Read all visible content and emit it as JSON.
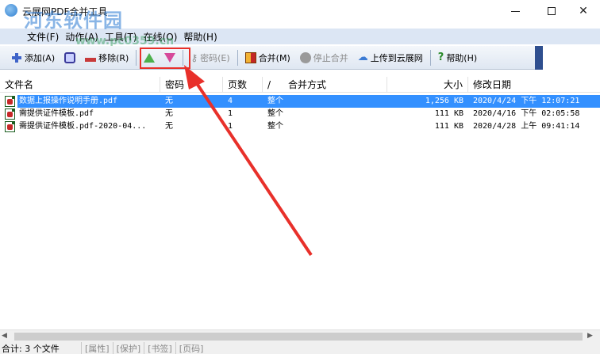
{
  "window": {
    "title": "云展网PDF合并工具",
    "watermark": "河东软件园",
    "watermark_url": "www.pc0359.cn"
  },
  "menu": [
    "文件(F)",
    "动作(A)",
    "工具(T)",
    "在线(O)",
    "帮助(H)"
  ],
  "toolbar": {
    "add": "添加(A)",
    "remove": "移除(R)",
    "password": "密码(E)",
    "merge": "合并(M)",
    "stop": "停止合并",
    "upload": "上传到云展网",
    "help": "帮助(H)"
  },
  "columns": {
    "filename": "文件名",
    "password": "密码",
    "pages": "页数",
    "sort_mark": "/",
    "merge_mode": "合并方式",
    "size": "大小",
    "modified": "修改日期"
  },
  "rows": [
    {
      "name": "数据上报操作说明手册.pdf",
      "password": "无",
      "pages": "4",
      "mode": "整个",
      "size": "1,256 KB",
      "date": "2020/4/24 下午 12:07:21"
    },
    {
      "name": "需提供证件模板.pdf",
      "password": "无",
      "pages": "1",
      "mode": "整个",
      "size": "111 KB",
      "date": "2020/4/16 下午 02:05:58"
    },
    {
      "name": "需提供证件模板.pdf-2020-04...",
      "password": "无",
      "pages": "1",
      "mode": "整个",
      "size": "111 KB",
      "date": "2020/4/28 上午 09:41:14"
    }
  ],
  "status": {
    "summary": "合计: 3 个文件",
    "tabs": [
      "[属性]",
      "[保护]",
      "[书签]",
      "[页码]"
    ]
  },
  "colors": {
    "selection": "#3390ff",
    "annotation": "#e8302a"
  }
}
